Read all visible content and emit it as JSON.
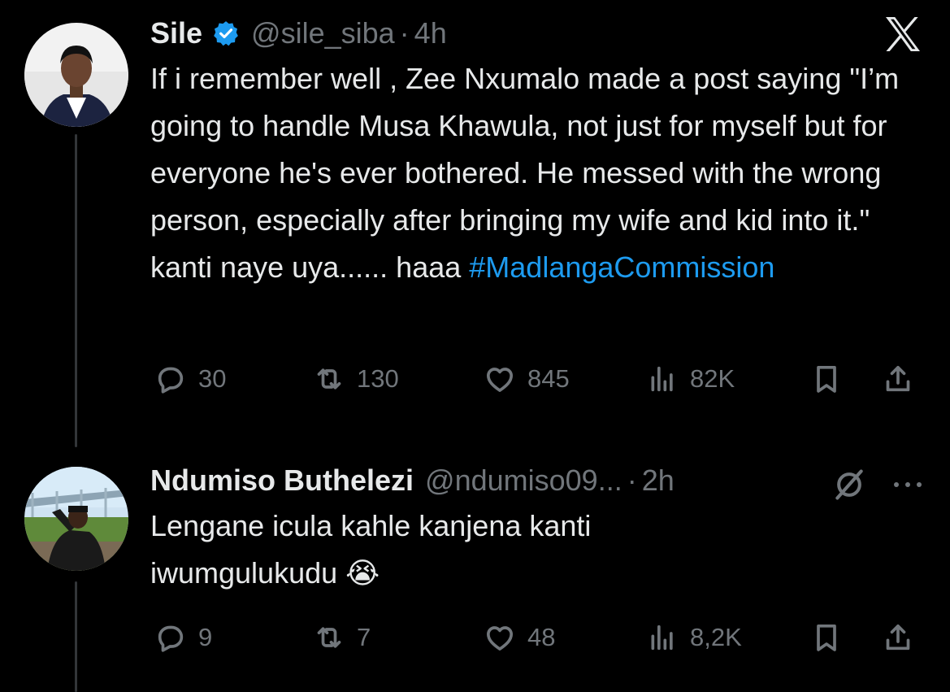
{
  "tweet1": {
    "name": "Sile",
    "handle": "@sile_siba",
    "separator": "·",
    "time": "4h",
    "text_main": "If i remember well , Zee Nxumalo made a post saying \"I’m going to handle Musa Khawula, not just for myself but for everyone he's ever bothered. He messed with the wrong person, especially after bringing my wife and kid into it.\" kanti naye uya...... haaa ",
    "hashtag": "#MadlangaCommission",
    "replies": "30",
    "reposts": "130",
    "likes": "845",
    "views": "82K"
  },
  "tweet2": {
    "name": "Ndumiso Buthelezi",
    "handle": "@ndumiso09...",
    "separator": "·",
    "time": "2h",
    "text": "Lengane icula kahle kanjena kanti iwumgulukudu 😭",
    "replies": "9",
    "reposts": "7",
    "likes": "48",
    "views": "8,2K"
  },
  "colors": {
    "background": "#000000",
    "text": "#e7e9ea",
    "muted": "#71767b",
    "accent": "#1d9bf0"
  },
  "icons": [
    "x-logo-icon",
    "verified-badge-icon",
    "reply-icon",
    "repost-icon",
    "like-icon",
    "views-icon",
    "bookmark-icon",
    "share-icon",
    "grok-icon",
    "more-icon"
  ]
}
